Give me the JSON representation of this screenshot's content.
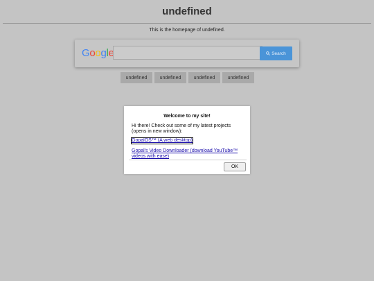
{
  "header": {
    "title": "undefined",
    "subtitle": "This is the homepage of undefined."
  },
  "search": {
    "logo_letters": [
      "G",
      "o",
      "o",
      "g",
      "l",
      "e"
    ],
    "logo_colors": [
      "#4285f4",
      "#ea4335",
      "#fbbc05",
      "#4285f4",
      "#34a853",
      "#ea4335"
    ],
    "input_value": "",
    "button_label": "Search",
    "button_icon": "search-icon",
    "button_color": "#4a94d8"
  },
  "nav": {
    "items": [
      {
        "label": "undefined"
      },
      {
        "label": "undefined"
      },
      {
        "label": "undefined"
      },
      {
        "label": "undefined"
      }
    ]
  },
  "dialog": {
    "title": "Welcome to my site!",
    "body": "Hi there! Check out some of my latest projects (opens in new window):",
    "links": [
      {
        "label": "GopalOS™ (A web desktop)"
      },
      {
        "label": "Gopal's Video Downloader (download YouTube™ videos with ease)"
      }
    ],
    "ok_label": "OK"
  }
}
